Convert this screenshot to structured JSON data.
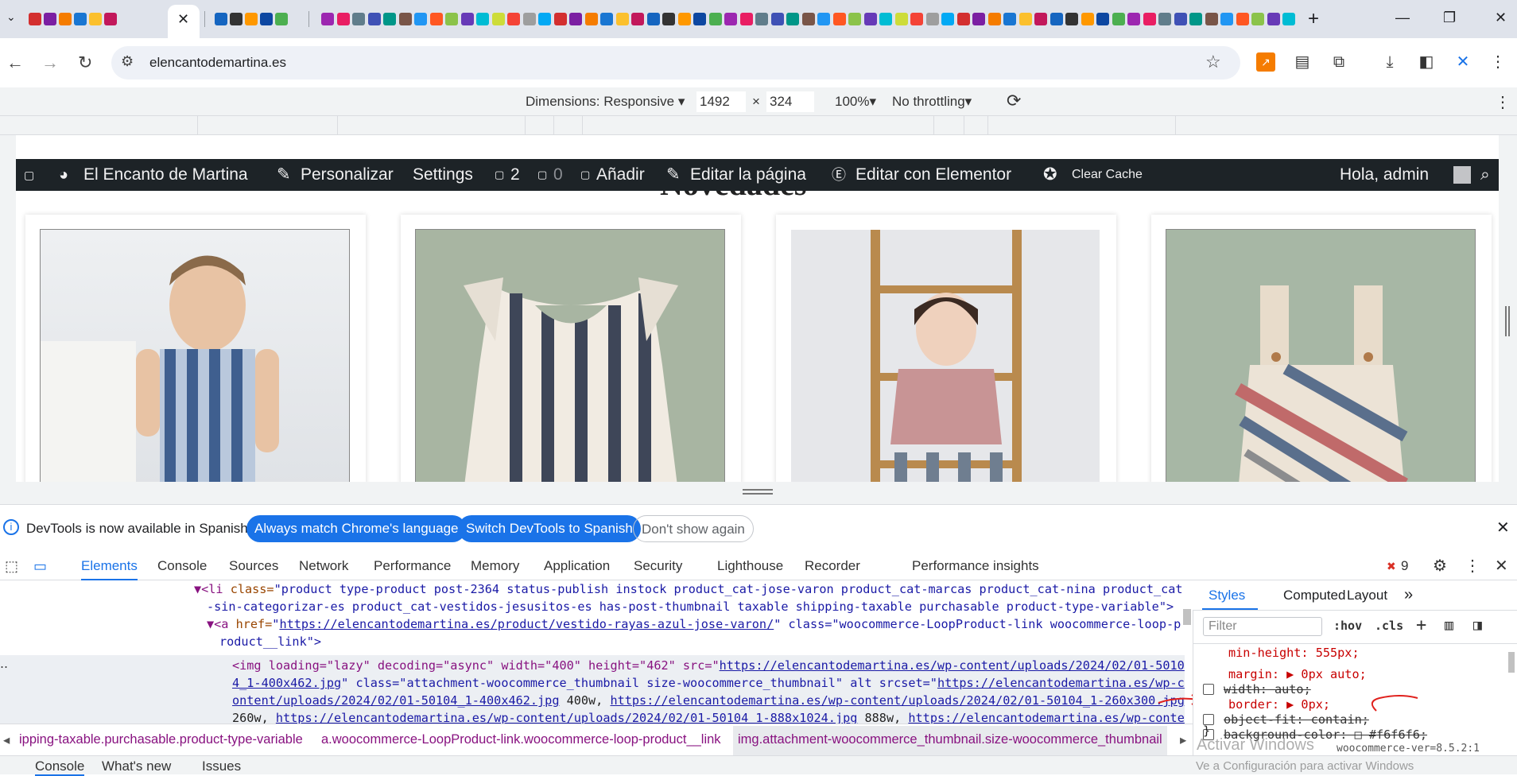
{
  "tabs": {
    "active_close": "✕",
    "new_tab": "+",
    "favicon_colors": [
      "#d32f2f",
      "#7b1fa2",
      "#f57c00",
      "#1976d2",
      "#fbc02d",
      "#c2185b",
      "#1565c0",
      "#333333",
      "#ff9800",
      "#0d47a1",
      "#4caf50",
      "#9c27b0",
      "#e91e63",
      "#607d8b",
      "#3f51b5",
      "#009688",
      "#795548",
      "#2196f3",
      "#ff5722",
      "#8bc34a",
      "#673ab7",
      "#00bcd4",
      "#cddc39",
      "#f44336",
      "#9e9e9e",
      "#03a9f4"
    ]
  },
  "window": {
    "minimize": "—",
    "restore": "❐",
    "close": "✕"
  },
  "address": {
    "url": "elencantodemartina.es"
  },
  "device_toolbar": {
    "dimensions_label": "Dimensions: Responsive",
    "width": "1492",
    "times": "×",
    "height": "324",
    "zoom": "100%",
    "throttling": "No throttling"
  },
  "adminbar": {
    "site_name": "El Encanto de Martina",
    "customize": "Personalizar",
    "settings": "Settings",
    "comments": "2",
    "updates": "0",
    "add_new": "Añadir",
    "edit_page": "Editar la página",
    "edit_elementor": "Editar con Elementor",
    "clear_cache": "Clear Cache",
    "greeting": "Hola, admin"
  },
  "page": {
    "section_heading": "Novedades"
  },
  "infobar": {
    "message": "DevTools is now available in Spanish!",
    "btn_match": "Always match Chrome's language",
    "btn_switch": "Switch DevTools to Spanish",
    "btn_dismiss": "Don't show again"
  },
  "devtools_tabs": [
    "Elements",
    "Console",
    "Sources",
    "Network",
    "Performance",
    "Memory",
    "Application",
    "Security",
    "Lighthouse",
    "Recorder",
    "Performance insights"
  ],
  "error_count": "9",
  "elements_lines": {
    "l1_tag": "▼<li ",
    "l1_attr": "class=",
    "l1_val": "\"product type-product post-2364 status-publish instock product_cat-jose-varon product_cat-marcas product_cat-nina product_cat",
    "l2": "-sin-categorizar-es product_cat-vestidos-jesusitos-es has-post-thumbnail taxable shipping-taxable purchasable product-type-variable\">",
    "l3_tag": "▼<a ",
    "l3_attr": "href=",
    "l3_link": "https://elencantodemartina.es/product/vestido-rayas-azul-jose-varon/",
    "l3_rest": "\" class=\"woocommerce-LoopProduct-link woocommerce-loop-p",
    "l4": "roduct__link\">",
    "l5_pre": "<img loading=\"lazy\" decoding=\"async\" width=\"400\" height=\"462\" src=\"",
    "l5_link": "https://elencantodemartina.es/wp-content/uploads/2024/02/01-5010",
    "l6_link": "4_1-400x462.jpg",
    "l6_rest": "\" class=\"attachment-woocommerce_thumbnail size-woocommerce_thumbnail\" alt srcset=\"",
    "l6_link2": "https://elencantodemartina.es/wp-c",
    "l7_link": "ontent/uploads/2024/02/01-50104_1-400x462.jpg",
    "l7_mid": " 400w, ",
    "l7_link2": "https://elencantodemartina.es/wp-content/uploads/2024/02/01-50104_1-260x300.jpg",
    "l8_pre": "260w, ",
    "l8_link": "https://elencantodemartina.es/wp-content/uploads/2024/02/01-50104_1-888x1024.jpg",
    "l8_mid": " 888w, ",
    "l8_link2": "https://elencantodemartina.es/wp-conte"
  },
  "breadcrumbs": {
    "c1": "ipping-taxable.purchasable.product-type-variable",
    "c2": "a.woocommerce-LoopProduct-link.woocommerce-loop-product__link",
    "c3": "img.attachment-woocommerce_thumbnail.size-woocommerce_thumbnail"
  },
  "styles": {
    "tabs": [
      "Styles",
      "Computed",
      "Layout"
    ],
    "filter_placeholder": "Filter",
    "hov": ":hov",
    "cls": ".cls",
    "rules": [
      {
        "text": "min-height: 555px;",
        "struck": false
      },
      {
        "text": "margin: ▶ 0px auto;",
        "struck": false
      },
      {
        "text": "width: auto;",
        "struck": true
      },
      {
        "text": "border: ▶ 0px;",
        "struck": false
      },
      {
        "text": "object-fit: contain;",
        "struck": true
      },
      {
        "text": "background-color: □ #f6f6f6;",
        "struck": true
      }
    ],
    "brace": "}",
    "footer": "woocommerce-ver=8.5.2:1",
    "watermark_1": "Activar Windows",
    "watermark_2": "Ve a Configuración para activar Windows"
  },
  "drawer": {
    "console": "Console",
    "whats_new": "What's new",
    "issues": "Issues"
  }
}
